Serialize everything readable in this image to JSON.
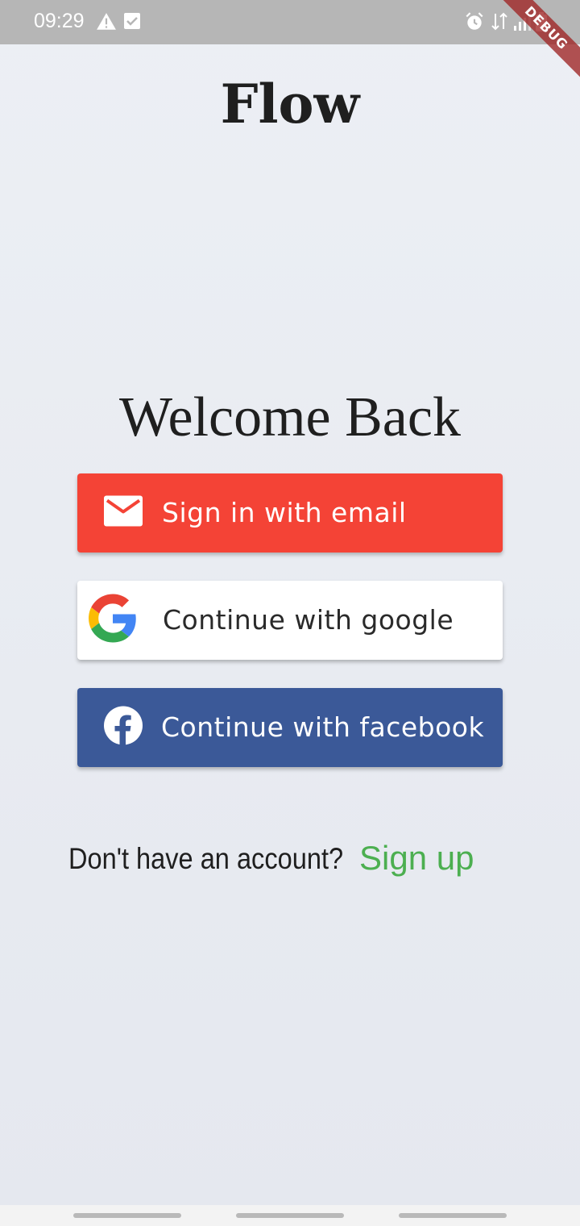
{
  "status_bar": {
    "time": "09:29",
    "icons": [
      "warning-icon",
      "checkbox-icon",
      "alarm-icon",
      "data-arrows-icon",
      "signal-icon",
      "battery-icon"
    ]
  },
  "debug_banner": "DEBUG",
  "app": {
    "title": "Flow",
    "welcome": "Welcome Back"
  },
  "buttons": {
    "email": {
      "label": "Sign in with email",
      "icon": "mail-icon",
      "color": "#f44336"
    },
    "google": {
      "label": "Continue with google",
      "icon": "google-logo-icon",
      "color": "#ffffff"
    },
    "facebook": {
      "label": "Continue with facebook",
      "icon": "facebook-logo-icon",
      "color": "#3b5998"
    }
  },
  "signup": {
    "question": "Don't have an account?",
    "link": "Sign up",
    "link_color": "#4caf50"
  }
}
